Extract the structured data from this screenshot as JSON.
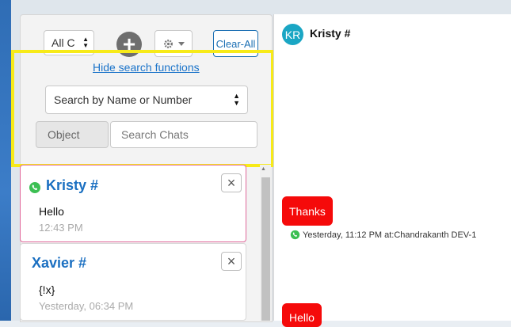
{
  "filters": {
    "type_select": "All C",
    "add_label": "+",
    "clear_all": "Clear-All",
    "hide_search": "Hide search functions",
    "search_by": "Search by Name or Number",
    "object_placeholder": "Object",
    "search_placeholder": "Search Chats"
  },
  "chat_list": [
    {
      "name": "Kristy #",
      "message": "Hello",
      "time": "12:43 PM",
      "channel": "whatsapp-icon",
      "active": true
    },
    {
      "name": "Xavier #",
      "message": "{!x}",
      "time": "Yesterday, 06:34 PM"
    }
  ],
  "conversation": {
    "avatar_initials": "KR",
    "contact_name": "Kristy #",
    "messages": [
      {
        "text": "Thanks",
        "meta": "Yesterday, 11:12 PM at:Chandrakanth DEV-1"
      },
      {
        "text": "Hello"
      }
    ]
  },
  "colors": {
    "accent": "#1a6fc1",
    "bubble": "#f50a0a",
    "highlight": "#f7ea18",
    "avatar": "#1aa6c4",
    "active_border": "#e0679a"
  }
}
